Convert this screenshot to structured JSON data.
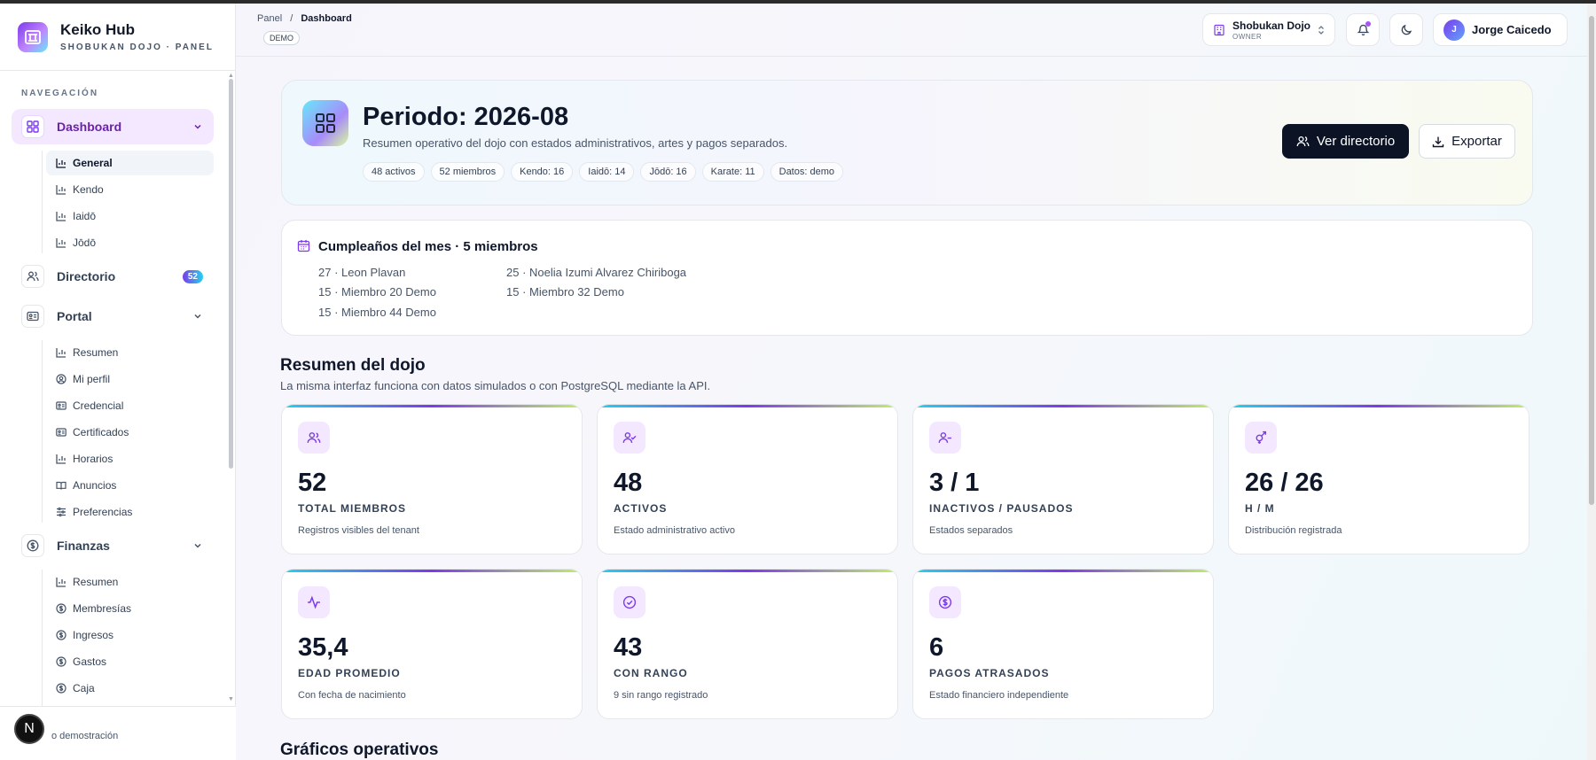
{
  "brand": {
    "name": "Keiko Hub",
    "subtitle": "SHOBUKAN DOJO · PANEL"
  },
  "sidebar": {
    "section_title": "NAVEGACIÓN",
    "dashboard": {
      "label": "Dashboard",
      "items": [
        "General",
        "Kendo",
        "Iaidō",
        "Jōdō"
      ]
    },
    "directorio": {
      "label": "Directorio",
      "badge": "52"
    },
    "portal": {
      "label": "Portal",
      "items": [
        "Resumen",
        "Mi perfil",
        "Credencial",
        "Certificados",
        "Horarios",
        "Anuncios",
        "Preferencias"
      ]
    },
    "finanzas": {
      "label": "Finanzas",
      "items": [
        "Resumen",
        "Membresías",
        "Ingresos",
        "Gastos",
        "Caja"
      ]
    },
    "footer_text": "o demostración",
    "footer_bubble": "N"
  },
  "header": {
    "breadcrumb_root": "Panel",
    "breadcrumb_sep": "/",
    "breadcrumb_current": "Dashboard",
    "demo_tag": "DEMO",
    "dojo_name": "Shobukan Dojo",
    "dojo_role": "OWNER",
    "user_initial": "J",
    "user_name": "Jorge Caicedo"
  },
  "hero": {
    "title": "Periodo: 2026-08",
    "description": "Resumen operativo del dojo con estados administrativos, artes y pagos separados.",
    "chips": [
      "48 activos",
      "52 miembros",
      "Kendo: 16",
      "Iaidō: 14",
      "Jōdō: 16",
      "Karate: 11",
      "Datos: demo"
    ],
    "btn_directory": "Ver directorio",
    "btn_export": "Exportar"
  },
  "birthdays": {
    "title": "Cumpleaños del mes · 5 miembros",
    "entries": [
      "27 · Leon Plavan",
      "25 · Noelia Izumi Alvarez Chiriboga",
      "15 · Miembro 20 Demo",
      "15 · Miembro 32 Demo",
      "15 · Miembro 44 Demo"
    ]
  },
  "summary": {
    "title": "Resumen del dojo",
    "subtitle": "La misma interfaz funciona con datos simulados o con PostgreSQL mediante la API.",
    "stats": [
      {
        "value": "52",
        "label": "TOTAL MIEMBROS",
        "desc": "Registros visibles del tenant",
        "icon": "users-icon"
      },
      {
        "value": "48",
        "label": "ACTIVOS",
        "desc": "Estado administrativo activo",
        "icon": "user-check-icon"
      },
      {
        "value": "3 / 1",
        "label": "INACTIVOS / PAUSADOS",
        "desc": "Estados separados",
        "icon": "user-minus-icon"
      },
      {
        "value": "26 / 26",
        "label": "H / M",
        "desc": "Distribución registrada",
        "icon": "gender-icon"
      },
      {
        "value": "35,4",
        "label": "EDAD PROMEDIO",
        "desc": "Con fecha de nacimiento",
        "icon": "activity-icon"
      },
      {
        "value": "43",
        "label": "CON RANGO",
        "desc": "9 sin rango registrado",
        "icon": "check-circle-icon"
      },
      {
        "value": "6",
        "label": "PAGOS ATRASADOS",
        "desc": "Estado financiero independiente",
        "icon": "dollar-circle-icon"
      }
    ]
  },
  "charts_section": {
    "title": "Gráficos operativos"
  },
  "colors": {
    "accent": "#7c3aed",
    "dark_button": "#0b1324",
    "active_nav_bg": "#f3e8ff"
  }
}
